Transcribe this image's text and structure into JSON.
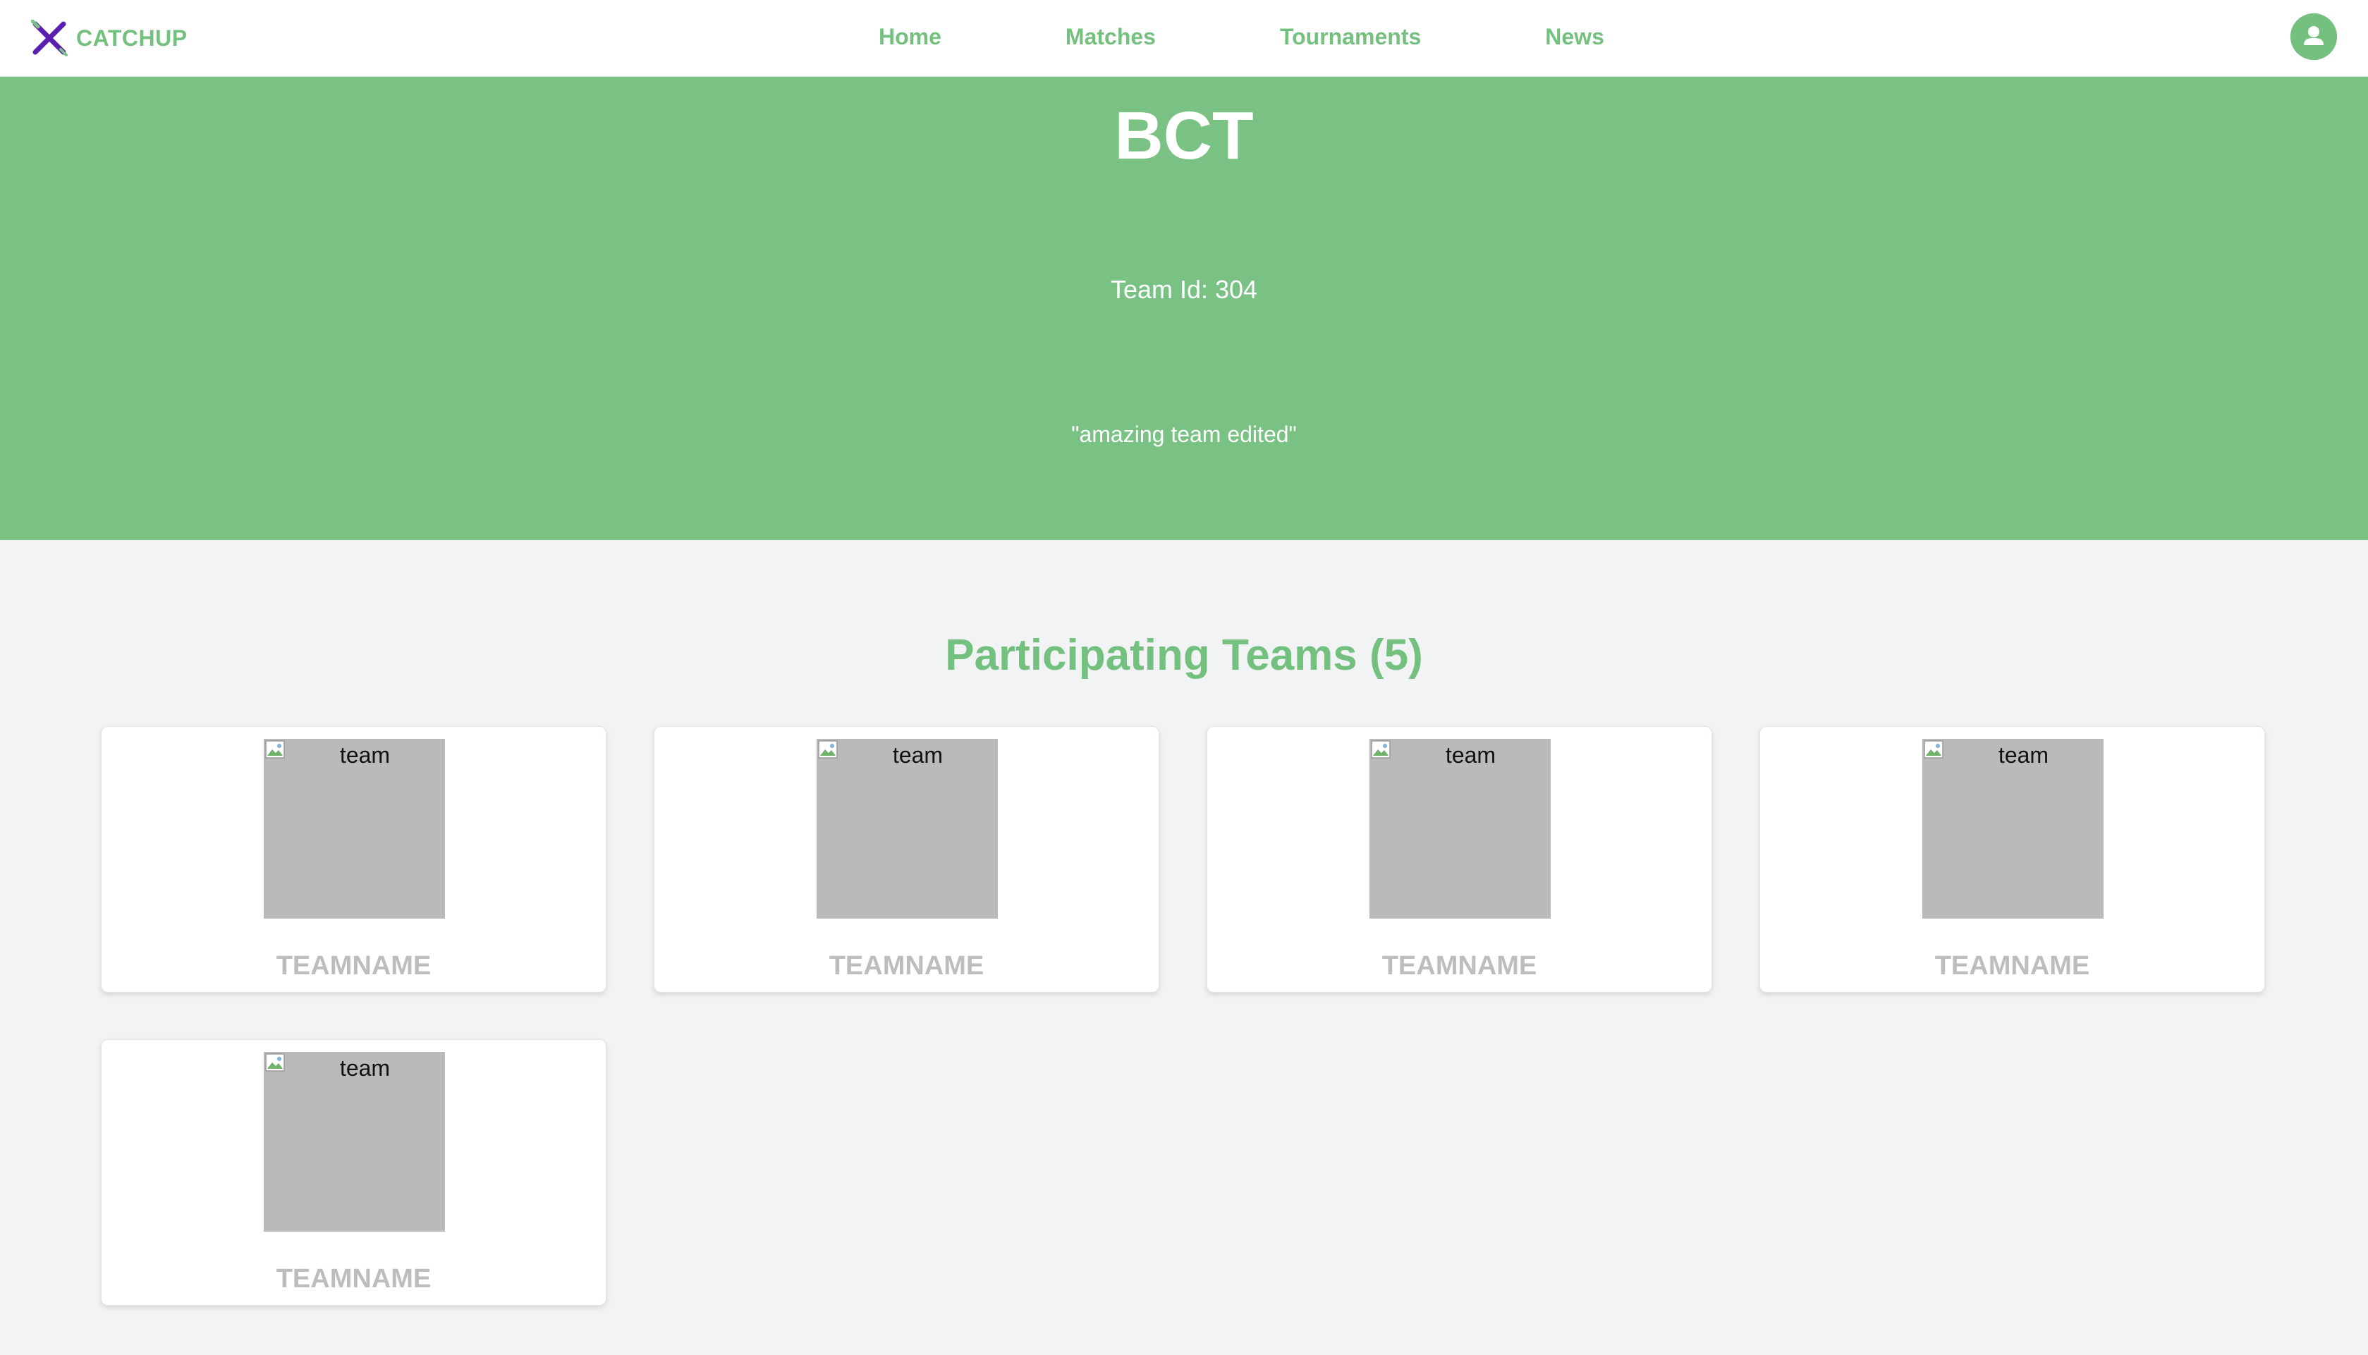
{
  "nav": {
    "brand": "CATCHUP",
    "links": [
      "Home",
      "Matches",
      "Tournaments",
      "News"
    ]
  },
  "hero": {
    "title": "BCT",
    "team_id": "Team Id: 304",
    "description": "\"amazing team edited\""
  },
  "teams_section": {
    "title": "Participating Teams (5)",
    "teams": [
      {
        "img_alt": "team",
        "name": "TEAMNAME"
      },
      {
        "img_alt": "team",
        "name": "TEAMNAME"
      },
      {
        "img_alt": "team",
        "name": "TEAMNAME"
      },
      {
        "img_alt": "team",
        "name": "TEAMNAME"
      },
      {
        "img_alt": "team",
        "name": "TEAMNAME"
      }
    ]
  },
  "colors": {
    "accent": "#74c07f",
    "hero_bg": "#7ac283",
    "page_bg": "#f2f3f5",
    "brand_icon": "#5b1fb0",
    "card_placeholder": "#bababa",
    "team_name": "#bdbdbd"
  },
  "icons": {
    "brand": "crossed-swords-icon",
    "profile": "user-avatar-icon",
    "broken_image": "broken-image-icon"
  }
}
